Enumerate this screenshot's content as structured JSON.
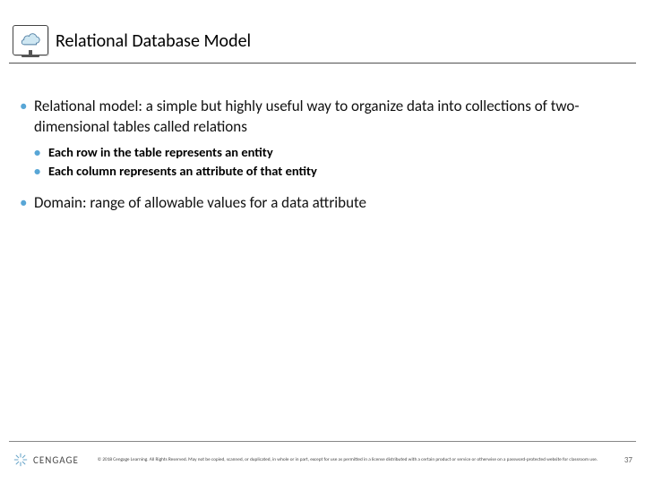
{
  "header": {
    "title": "Relational Database Model"
  },
  "body": {
    "items": [
      {
        "text": "Relational model: a simple but highly useful way to organize data into collections of two-dimensional tables called relations",
        "sub": [
          "Each row in the table represents an entity",
          "Each column represents an attribute of that entity"
        ]
      },
      {
        "text": "Domain: range of allowable values for a data attribute",
        "sub": []
      }
    ]
  },
  "footer": {
    "brand": "CENGAGE",
    "copyright": "© 2018 Cengage Learning. All Rights Reserved. May not be copied, scanned, or duplicated, in whole or in part, except for use as permitted in a license distributed with a certain product or service or otherwise on a password-protected website for classroom use.",
    "page": "37"
  },
  "icons": {
    "header_icon": "cloud-icon",
    "logo_icon": "cengage-burst-icon"
  }
}
